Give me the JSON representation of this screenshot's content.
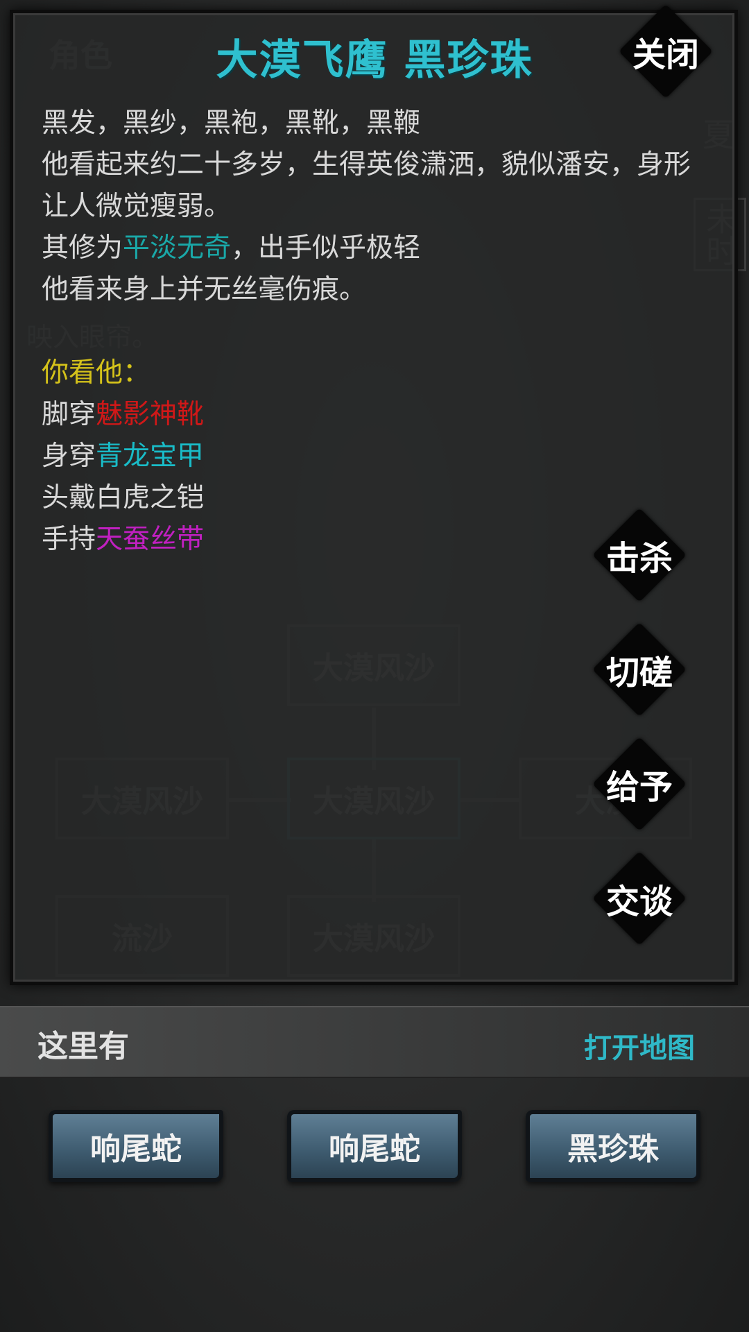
{
  "background": {
    "corner_label": "角色",
    "season": "夏",
    "time": "未时",
    "faded_line": "映入眼帘。",
    "rooms": [
      "大漠风沙",
      "大漠风沙",
      "大漠风沙",
      "大漠",
      "流沙",
      "大漠风沙"
    ]
  },
  "modal": {
    "title": "大漠飞鹰 黑珍珠",
    "close_label": "关闭",
    "description": {
      "outfit_line": "黑发，黑纱，黑袍，黑靴，黑鞭",
      "appearance_line": "他看起来约二十多岁，生得英俊潇洒，貌似潘安，身形让人微觉瘦弱。",
      "cultivation_prefix": "其修为",
      "cultivation_value": "平淡无奇",
      "cultivation_suffix": "，出手似乎极轻",
      "injury_line": "他看来身上并无丝毫伤痕。"
    },
    "equipment": {
      "header": "你看他：",
      "items": [
        {
          "prefix": "脚穿",
          "name": "魅影神靴",
          "color": "#d01818"
        },
        {
          "prefix": "身穿",
          "name": "青龙宝甲",
          "color": "#19bcc8"
        },
        {
          "prefix": "头戴",
          "name": "白虎之铠",
          "color": "#dcdcdc"
        },
        {
          "prefix": "手持",
          "name": "天蚕丝带",
          "color": "#c020c0"
        }
      ]
    },
    "actions": [
      "击杀",
      "切磋",
      "给予",
      "交谈"
    ]
  },
  "here": {
    "label": "这里有",
    "open_map": "打开地图",
    "npcs": [
      "响尾蛇",
      "响尾蛇",
      "黑珍珠"
    ]
  },
  "colors": {
    "title": "#2fc0cf",
    "cultivation": "#1aa8a8",
    "equip_header": "#d4c21a",
    "map_link": "#2fb9c8"
  }
}
